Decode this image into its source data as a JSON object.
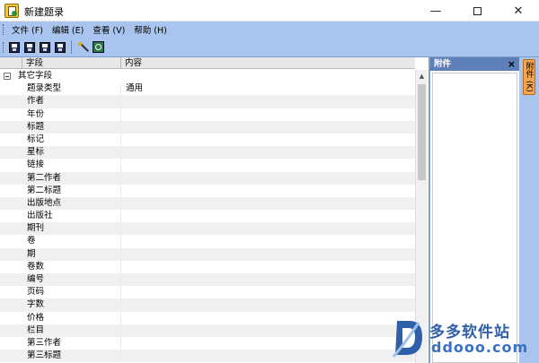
{
  "window": {
    "title": "新建题录",
    "minimize": "—",
    "close": "✕"
  },
  "menu": [
    {
      "label": "文件 (F)"
    },
    {
      "label": "编辑 (E)"
    },
    {
      "label": "查看 (V)"
    },
    {
      "label": "帮助 (H)"
    }
  ],
  "toolbar": {
    "icons": [
      "save-icon",
      "save-as-icon",
      "copy-icon",
      "save-close-icon",
      "wand-icon",
      "find-icon"
    ]
  },
  "grid": {
    "columns": [
      "字段",
      "内容"
    ],
    "group": "其它字段",
    "rows": [
      {
        "field": "题录类型",
        "value": "通用"
      },
      {
        "field": "作者",
        "value": ""
      },
      {
        "field": "年份",
        "value": ""
      },
      {
        "field": "标题",
        "value": ""
      },
      {
        "field": "标记",
        "value": ""
      },
      {
        "field": "星标",
        "value": ""
      },
      {
        "field": "链接",
        "value": ""
      },
      {
        "field": "第二作者",
        "value": ""
      },
      {
        "field": "第二标题",
        "value": ""
      },
      {
        "field": "出版地点",
        "value": ""
      },
      {
        "field": "出版社",
        "value": ""
      },
      {
        "field": "期刊",
        "value": ""
      },
      {
        "field": "卷",
        "value": ""
      },
      {
        "field": "期",
        "value": ""
      },
      {
        "field": "卷数",
        "value": ""
      },
      {
        "field": "编号",
        "value": ""
      },
      {
        "field": "页码",
        "value": ""
      },
      {
        "field": "字数",
        "value": ""
      },
      {
        "field": "价格",
        "value": ""
      },
      {
        "field": "栏目",
        "value": ""
      },
      {
        "field": "第三作者",
        "value": ""
      },
      {
        "field": "第三标题",
        "value": ""
      }
    ]
  },
  "attachments": {
    "title": "附件",
    "close": "×"
  },
  "edge_tab": {
    "label": "附件 (K)"
  },
  "watermark": {
    "line1": "多多软件站",
    "line2": "ddooo.com"
  }
}
